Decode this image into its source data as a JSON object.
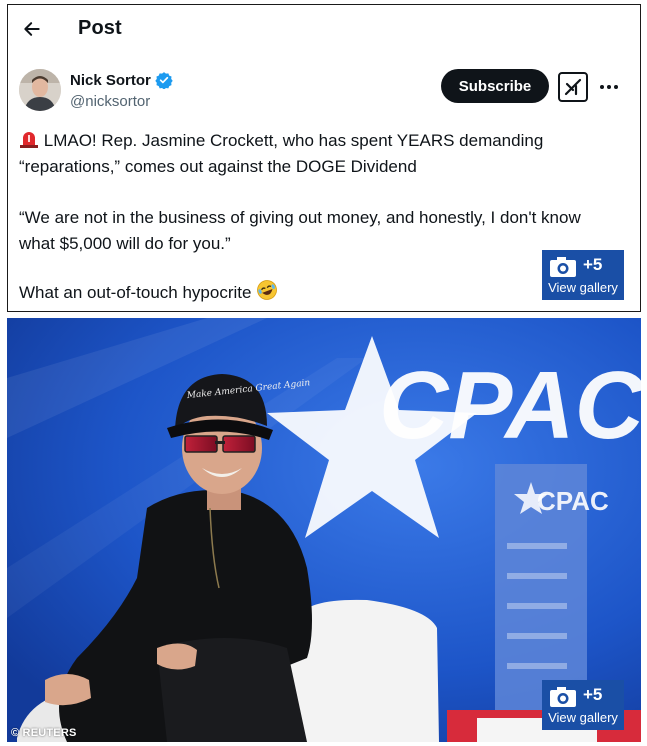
{
  "header": {
    "title": "Post"
  },
  "author": {
    "name": "Nick Sortor",
    "handle": "@nicksortor"
  },
  "actions": {
    "subscribe_label": "Subscribe"
  },
  "tweet": {
    "paragraph_1": "LMAO! Rep. Jasmine Crockett, who has spent YEARS demanding “reparations,” comes out against the DOGE Dividend",
    "paragraph_2": "“We are not in the business of giving out money, and honestly, I don't know what $5,000 will do for you.”",
    "paragraph_3": "What an out-of-touch hypocrite"
  },
  "gallery": {
    "count_label": "+5",
    "view_label": "View gallery"
  },
  "photo": {
    "credit": "© REUTERS",
    "backdrop_text": "CPAC",
    "banner_text": "CPAC",
    "hat_text": "Make America Great Again"
  },
  "colors": {
    "verified": "#1d9bf0",
    "gallery_blue": "#1a4fa6",
    "backdrop_blue": "#1c55c7"
  },
  "icons": [
    "back-arrow-icon",
    "verified-badge-icon",
    "grok-icon",
    "more-dots-icon",
    "siren-icon",
    "laughing-emoji-icon",
    "camera-icon"
  ]
}
